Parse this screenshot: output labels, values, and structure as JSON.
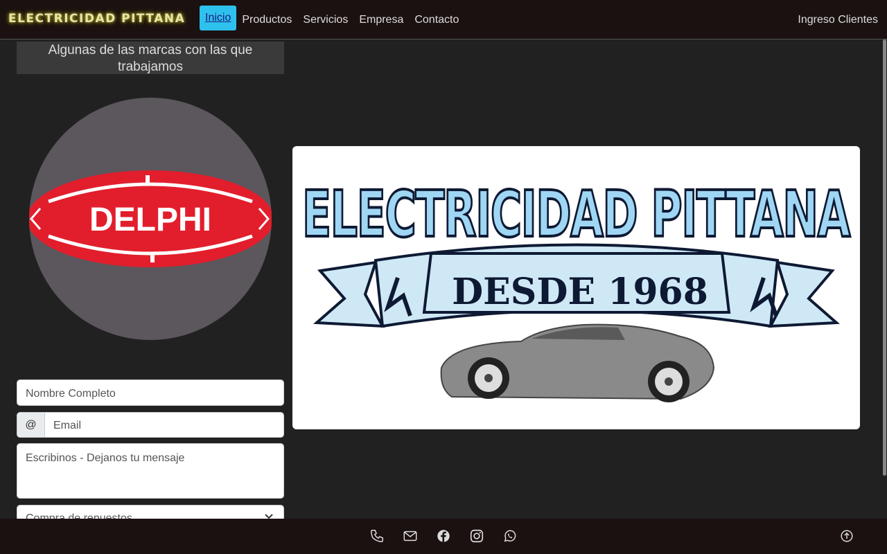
{
  "navbar": {
    "brand": "ELECTRICIDAD PITTANA",
    "links": [
      "Inicio",
      "Productos",
      "Servicios",
      "Empresa",
      "Contacto"
    ],
    "right_link": "Ingreso Clientes"
  },
  "brands": {
    "title": "Algunas de las marcas con las que trabajamos",
    "current_brand": "DELPHI"
  },
  "form": {
    "name_placeholder": "Nombre Completo",
    "email_addon": "@",
    "email_placeholder": "Email",
    "message_placeholder": "Escribinos - Dejanos tu mensaje",
    "select_value": "Compra de repuestos"
  },
  "hero": {
    "title": "ELECTRICIDAD PITTANA",
    "banner": "DESDE 1968"
  },
  "footer": {
    "icons": [
      "phone-icon",
      "mail-icon",
      "facebook-icon",
      "instagram-icon",
      "whatsapp-icon",
      "arrow-up-circle-icon"
    ]
  },
  "colors": {
    "active_nav": "#2fc1ee",
    "delphi_red": "#e21e2c",
    "logo_blue": "#9fd6f4"
  }
}
